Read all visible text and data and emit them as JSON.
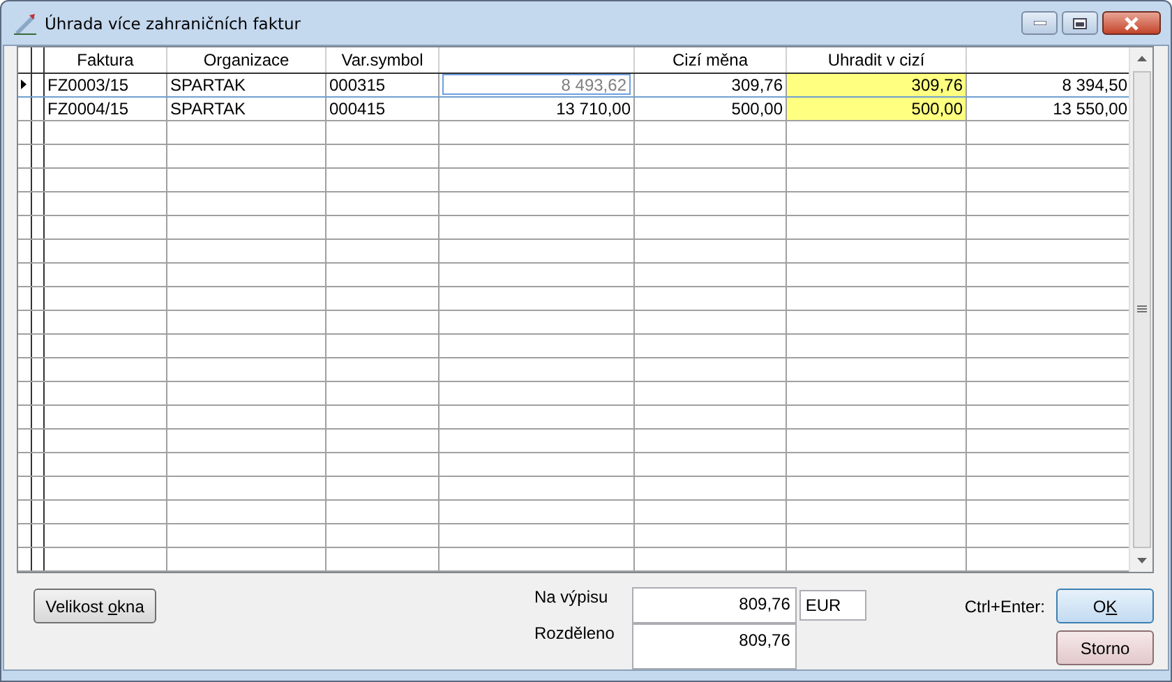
{
  "window": {
    "title": "Úhrada více zahraničních faktur"
  },
  "table": {
    "columns": [
      {
        "label": "Faktura",
        "kind": "text"
      },
      {
        "label": "Organizace",
        "kind": "text"
      },
      {
        "label": "Var.symbol",
        "kind": "text"
      },
      {
        "kind": "editable"
      },
      {
        "label": "Cizí měna",
        "kind": "number"
      },
      {
        "label": "Uhradit v cizí",
        "kind": "highlight"
      },
      {
        "kind": "number"
      }
    ],
    "rows": [
      {
        "selected": true,
        "cells": [
          "FZ0003/15",
          "SPARTAK",
          "000315",
          "8 493,62",
          "309,76",
          "309,76",
          "8 394,50"
        ]
      },
      {
        "selected": false,
        "cells": [
          "FZ0004/15",
          "SPARTAK",
          "000415",
          "13 710,00",
          "500,00",
          "500,00",
          "13 550,00"
        ]
      }
    ]
  },
  "resize_button": {
    "label_before": "Velikost ",
    "accel_key": "o",
    "label_after": "kna"
  },
  "totals": [
    {
      "label": "Na výpisu",
      "value": "809,76",
      "currency": "EUR"
    },
    {
      "label": "Rozděleno",
      "value": "809,76"
    }
  ],
  "shortcut": "Ctrl+Enter:",
  "ok_button": {
    "label_before": "O",
    "accel_key": "K"
  },
  "cancel_button": {
    "label": "Storno"
  }
}
